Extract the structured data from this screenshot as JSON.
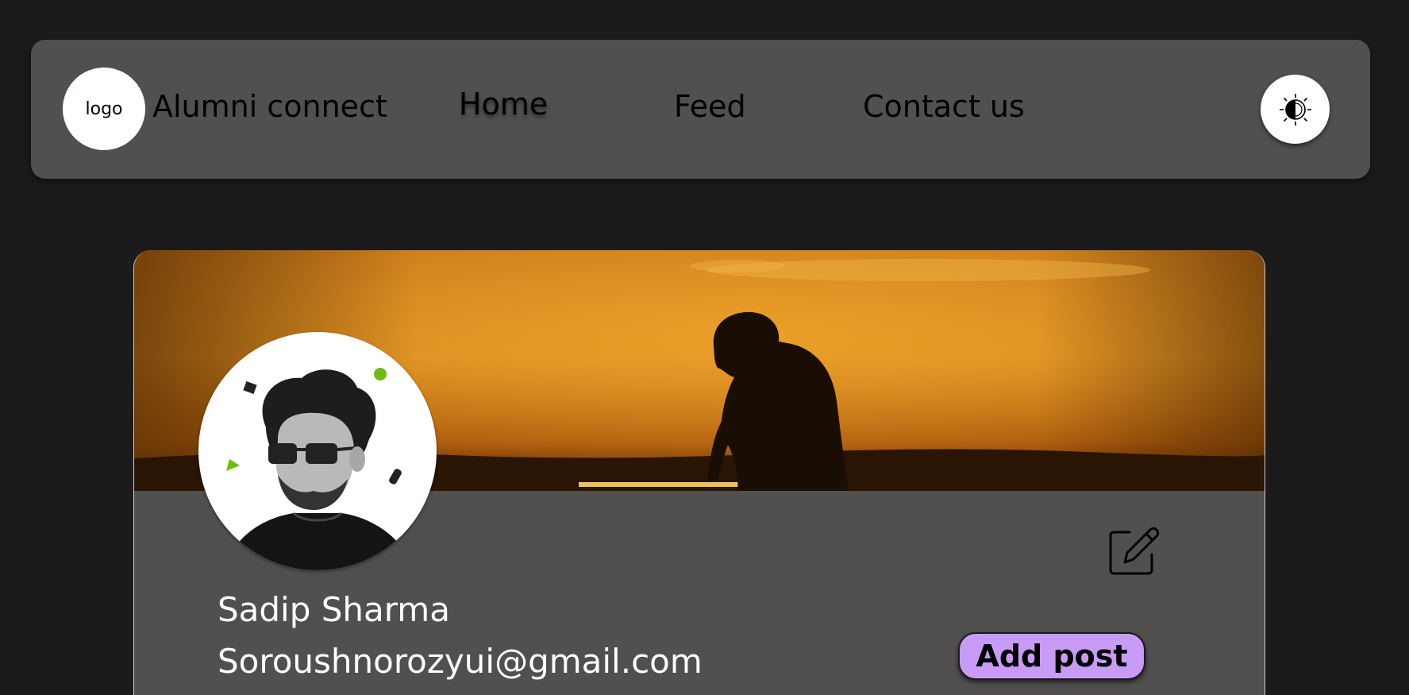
{
  "header": {
    "logo_text": "logo",
    "brand": "Alumni connect",
    "nav": {
      "home": "Home",
      "feed": "Feed",
      "contact": "Contact us"
    },
    "theme_toggle_icon": "contrast-icon"
  },
  "profile": {
    "name": "Sadip Sharma",
    "email": "Soroushnorozyui@gmail.com",
    "add_post_label": "Add post",
    "edit_icon": "edit-icon"
  },
  "colors": {
    "background": "#1b1b1b",
    "panel": "#524f4f",
    "accent_button": "#c89cf6"
  }
}
